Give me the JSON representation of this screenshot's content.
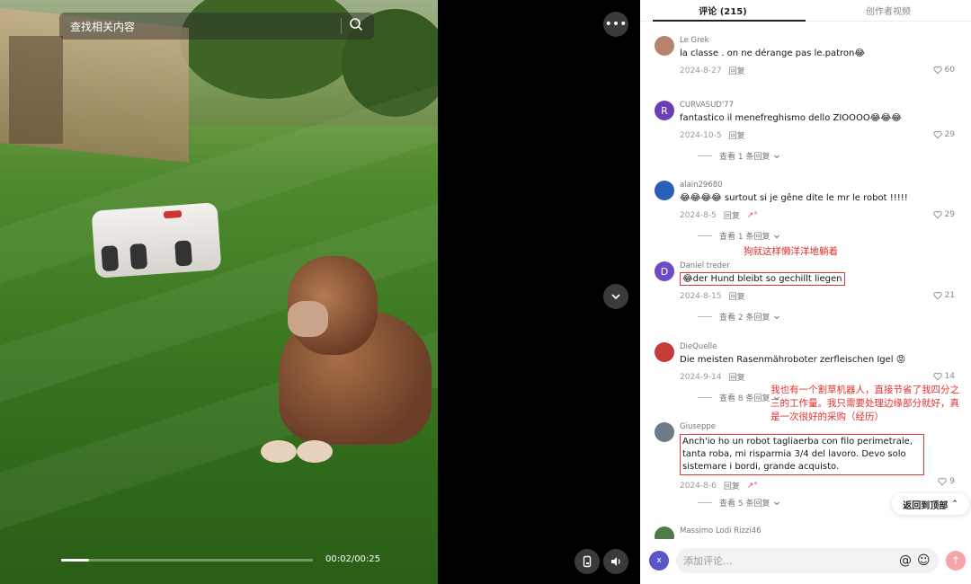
{
  "video": {
    "search_text": "查找相关内容",
    "time": "00:02/00:25",
    "progress_fraction": 0.11
  },
  "tabs": [
    {
      "label": "评论 (215)"
    },
    {
      "label": "创作者视频"
    }
  ],
  "comments": [
    {
      "user": "Le Grek",
      "text": "la classe . on ne dérange pas le.patron😂",
      "date": "2024-8-27",
      "reply": "回复",
      "likes": "60",
      "avatar_color": "#b9826a",
      "avatar_letter": ""
    },
    {
      "user": "CURVASUD'77",
      "text": "fantastico il menefreghismo dello ZIOOOO😂😂😂",
      "date": "2024-10-5",
      "reply": "回复",
      "likes": "29",
      "more": "查看 1 条回复",
      "avatar_color": "#6a3fb5",
      "avatar_letter": "R"
    },
    {
      "user": "alain29680",
      "text": "😂😂😂😂 surtout si je gêne dite le mr le robot !!!!!",
      "date": "2024-8-5",
      "reply": "回复",
      "likes": "29",
      "more": "查看 1 条回复",
      "avatar_color": "#2a5fb8",
      "avatar_letter": ""
    },
    {
      "user": "Daniel treder",
      "text": "😂der Hund bleibt so gechillt liegen",
      "date": "2024-8-15",
      "reply": "回复",
      "likes": "21",
      "more": "查看 2 条回复",
      "avatar_color": "#6d4bc4",
      "avatar_letter": "D",
      "note": "狗就这样懒洋洋地躺着"
    },
    {
      "user": "DieQuelle",
      "text": "Die meisten Rasenmähroboter zerfleischen Igel 😡",
      "date": "2024-9-14",
      "reply": "回复",
      "likes": "14",
      "more": "查看 8 条回复",
      "avatar_color": "#c63a3a",
      "avatar_letter": ""
    },
    {
      "user": "Giuseppe",
      "text": "Anch'io ho un robot tagliaerba con filo perimetrale, tanta roba, mi risparmia 3/4 del lavoro. Devo solo sistemare i bordi, grande acquisto.",
      "date": "2024-8-6",
      "reply": "回复",
      "likes": "9",
      "more": "查看 5 条回复",
      "avatar_color": "#6e7a88",
      "avatar_letter": "",
      "note": "我也有一个割草机器人，直接节省了我四分之三的工作量。我只需要处理边缘部分就好，真是一次很好的采购（经历）"
    },
    {
      "user": "Massimo Lodi Rizzi46",
      "avatar_color": "#4f7a4a",
      "avatar_letter": ""
    }
  ],
  "back_to_top": "返回到顶部",
  "input": {
    "placeholder": "添加评论...",
    "avatar_letter": "x"
  }
}
